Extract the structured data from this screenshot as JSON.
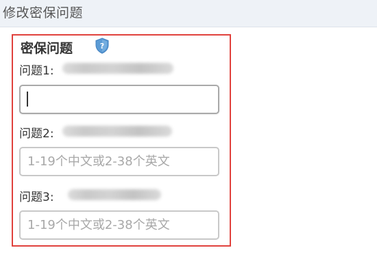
{
  "header": {
    "title": "修改密保问题"
  },
  "panel": {
    "title": "密保问题",
    "questions": [
      {
        "label": "问题1:",
        "value": "",
        "placeholder": ""
      },
      {
        "label": "问题2:",
        "value": "",
        "placeholder": "1-19个中文或2-38个英文"
      },
      {
        "label": "问题3:",
        "value": "",
        "placeholder": "1-19个中文或2-38个英文"
      }
    ]
  },
  "colors": {
    "highlight_border": "#e0413c",
    "shield_icon": "#5b9bd5",
    "header_bg": "#eef2f7"
  },
  "icons": {
    "title_icon": "shield-question-icon"
  }
}
